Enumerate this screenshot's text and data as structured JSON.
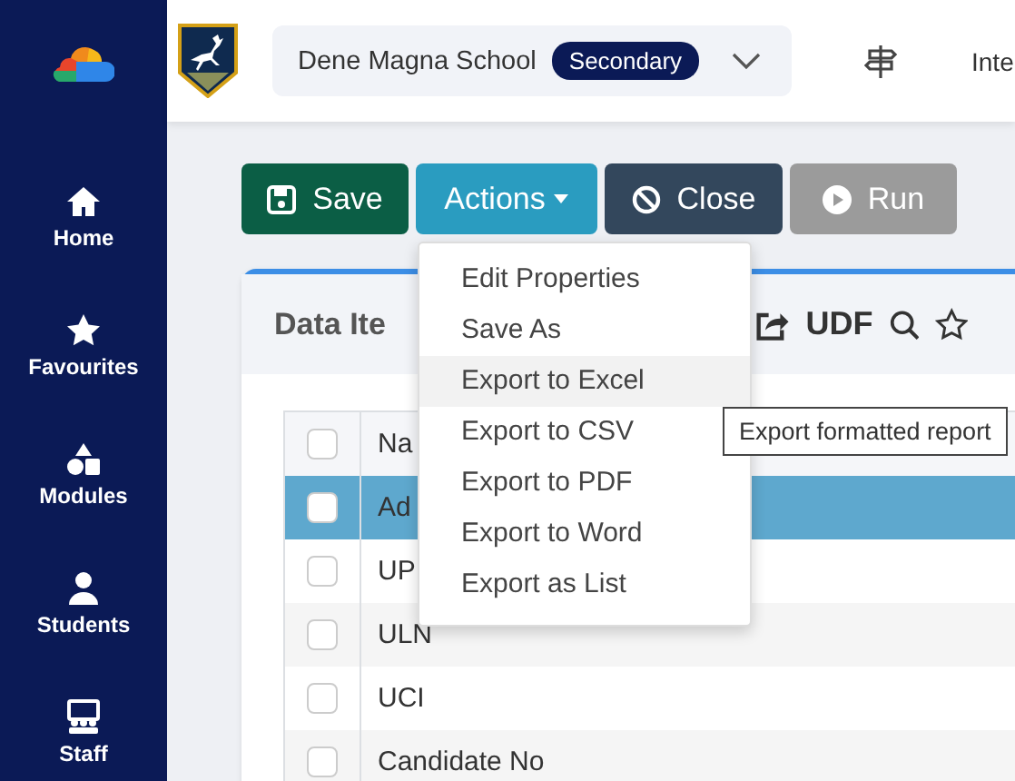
{
  "sidebar": {
    "items": [
      {
        "label": "Home"
      },
      {
        "label": "Favourites"
      },
      {
        "label": "Modules"
      },
      {
        "label": "Students"
      },
      {
        "label": "Staff"
      }
    ]
  },
  "top_bar": {
    "school": "Dene Magna School",
    "phase_badge": "Secondary",
    "nav_text": "Inte"
  },
  "toolbar": {
    "buttons": [
      {
        "kind": "save",
        "label": "Save"
      },
      {
        "kind": "actions",
        "label": "Actions"
      },
      {
        "kind": "close",
        "label": "Close"
      },
      {
        "kind": "run",
        "label": "Run"
      }
    ]
  },
  "actions_menu": {
    "items": [
      {
        "label": "Edit Properties",
        "hovered": false
      },
      {
        "label": "Save As",
        "hovered": false
      },
      {
        "label": "Export to Excel",
        "hovered": true
      },
      {
        "label": "Export to CSV",
        "hovered": false
      },
      {
        "label": "Export to PDF",
        "hovered": false
      },
      {
        "label": "Export to Word",
        "hovered": false
      },
      {
        "label": "Export as List",
        "hovered": false
      }
    ]
  },
  "tooltip": "Export formatted report",
  "panel": {
    "title": "Data Ite",
    "udf_label": "UDF",
    "table": {
      "header": {
        "checked": false,
        "column_2": "Na"
      },
      "rows": [
        {
          "checked": false,
          "selected": true,
          "cell": "Ad"
        },
        {
          "checked": false,
          "selected": false,
          "cell": "UP"
        },
        {
          "checked": false,
          "selected": false,
          "cell": "ULN"
        },
        {
          "checked": false,
          "selected": false,
          "cell": "UCI"
        },
        {
          "checked": false,
          "selected": false,
          "cell": "Candidate No"
        }
      ]
    }
  }
}
